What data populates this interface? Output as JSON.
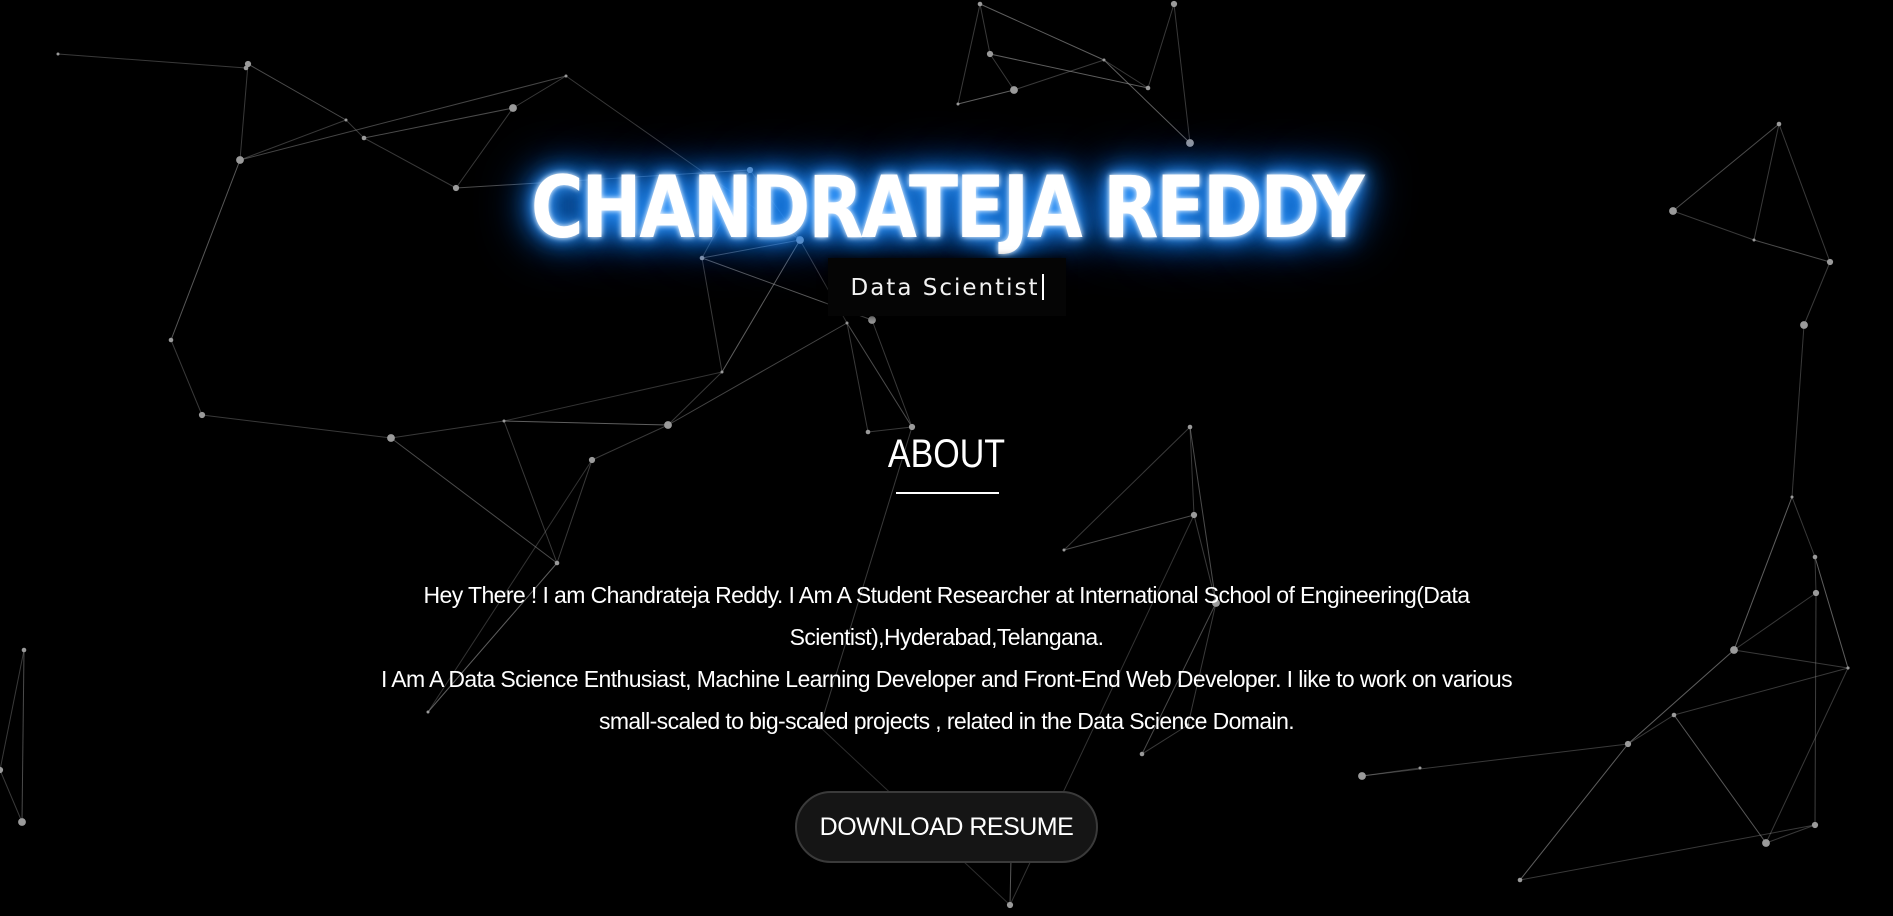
{
  "hero": {
    "name": "CHANDRATEJA REDDY",
    "typed_role": "Data Scientist",
    "glow_color": "#1a8cff"
  },
  "about": {
    "heading": "ABOUT",
    "paragraph_1": "Hey There ! I am Chandrateja Reddy. I Am A Student Researcher at International School of Engineering(Data Scientist),Hyderabad,Telangana.",
    "paragraph_2": "I Am A Data Science Enthusiast, Machine Learning Developer and Front-End Web Developer. I like to work on various small-scaled to big-scaled projects , related in the Data Science Domain."
  },
  "actions": {
    "download_resume_label": "DOWNLOAD RESUME"
  },
  "background": {
    "color": "#000000",
    "line_color": "#9a9a9a"
  }
}
